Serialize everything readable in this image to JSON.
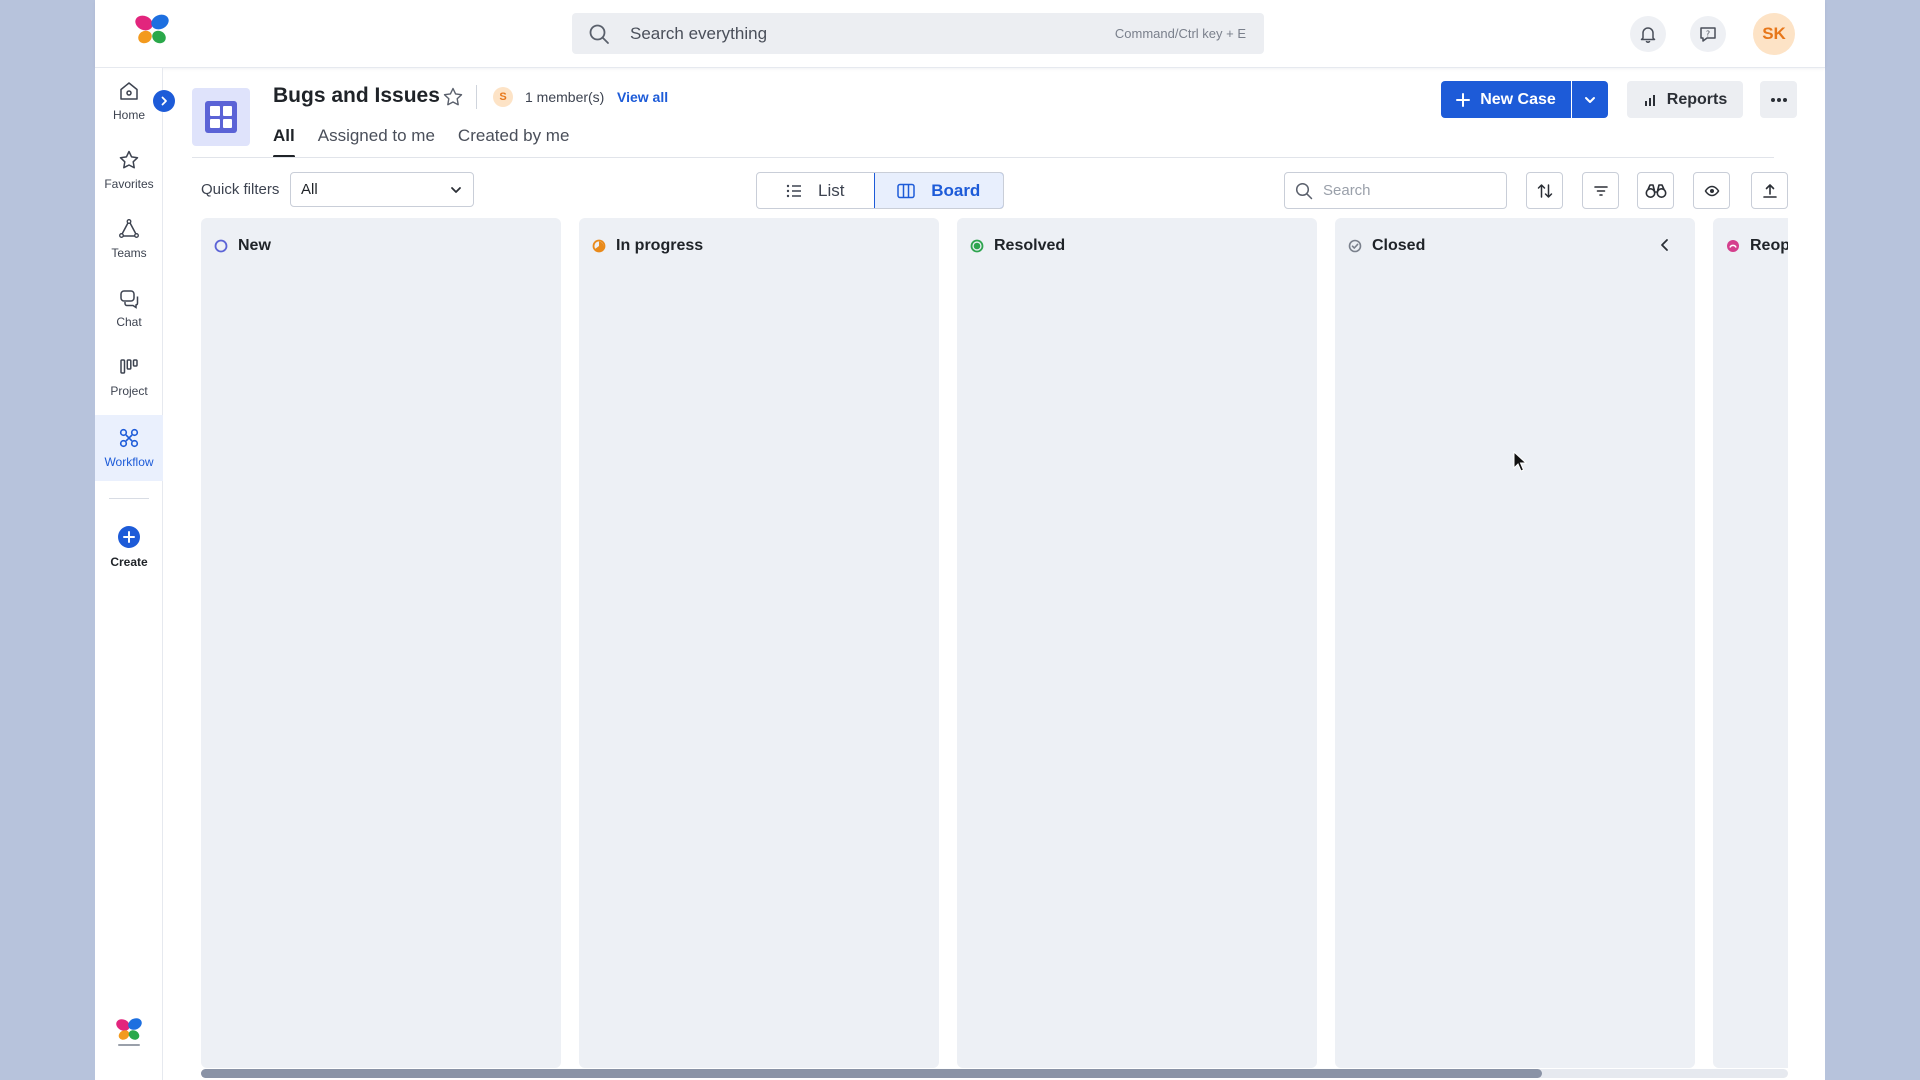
{
  "topbar": {
    "search_placeholder": "Search everything",
    "search_hint": "Command/Ctrl key + E",
    "user_initials": "SK"
  },
  "rail": {
    "items": [
      {
        "label": "Home",
        "icon": "home-icon"
      },
      {
        "label": "Favorites",
        "icon": "star-icon"
      },
      {
        "label": "Teams",
        "icon": "teams-icon"
      },
      {
        "label": "Chat",
        "icon": "chat-icon"
      },
      {
        "label": "Project",
        "icon": "project-icon"
      },
      {
        "label": "Workflow",
        "icon": "workflow-icon",
        "active": true
      }
    ],
    "create_label": "Create"
  },
  "header": {
    "title": "Bugs and Issues",
    "member_initial": "S",
    "members_text": "1 member(s)",
    "view_all": "View all",
    "new_case": "New Case",
    "reports": "Reports",
    "tabs": [
      {
        "label": "All",
        "active": true
      },
      {
        "label": "Assigned to me"
      },
      {
        "label": "Created by me"
      }
    ]
  },
  "toolbar": {
    "quick_filters_label": "Quick filters",
    "quick_filter_value": "All",
    "view_list": "List",
    "view_board": "Board",
    "search_placeholder": "Search"
  },
  "board": {
    "columns": [
      {
        "title": "New",
        "status_color": "#5b63d6"
      },
      {
        "title": "In progress",
        "status_color": "#e98a1a"
      },
      {
        "title": "Resolved",
        "status_color": "#2ea44f"
      },
      {
        "title": "Closed",
        "status_color": "#7a808c"
      },
      {
        "title": "Reop",
        "status_color": "#d43f8d"
      }
    ]
  },
  "colors": {
    "accent": "#1d5bd8",
    "background": "#b7c3dc"
  }
}
